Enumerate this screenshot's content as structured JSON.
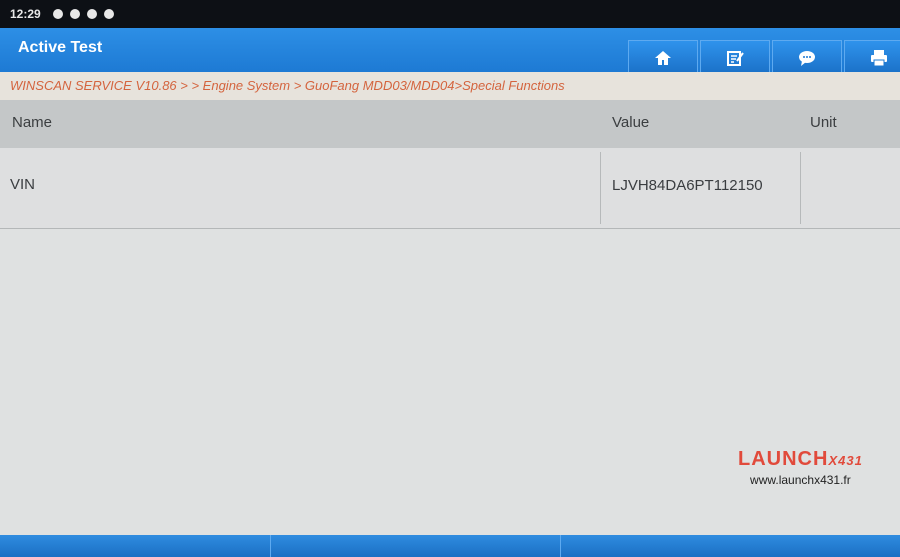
{
  "status_bar": {
    "time": "12:29"
  },
  "header": {
    "title": "Active Test"
  },
  "toolbar": [
    {
      "icon": "home-icon"
    },
    {
      "icon": "report-icon"
    },
    {
      "icon": "message-icon"
    },
    {
      "icon": "print-icon"
    }
  ],
  "breadcrumb": "WINSCAN SERVICE V10.86 > > Engine System > GuoFang MDD03/MDD04>Special Functions",
  "table": {
    "columns": [
      "Name",
      "Value",
      "Unit"
    ],
    "rows": [
      {
        "name": "VIN",
        "value": "LJVH84DA6PT112150",
        "unit": ""
      }
    ]
  },
  "watermark": {
    "brand": "LAUNCH",
    "model": "X431",
    "url": "www.launchx431.fr"
  },
  "colors": {
    "accent": "#1c78d2",
    "breadcrumb_text": "#d4643e",
    "watermark_red": "#e14a3b"
  }
}
